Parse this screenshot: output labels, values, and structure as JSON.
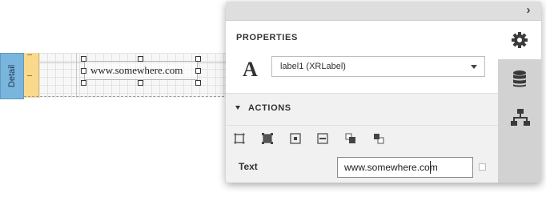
{
  "designer": {
    "band_label": "Detail",
    "label_text": "www.somewhere.com"
  },
  "panel": {
    "title": "PROPERTIES",
    "selected_component": "label1 (XRLabel)",
    "component_icon_glyph": "A",
    "actions_title": "ACTIONS",
    "text_property_label": "Text",
    "text_property_value": "www.somewhere.com",
    "side_tabs": [
      "gear-icon",
      "database-icon",
      "hierarchy-icon"
    ],
    "action_buttons": [
      "fit-bounds-to-text-icon",
      "fit-text-to-bounds-icon",
      "align-to-grid-icon",
      "size-to-grid-icon",
      "send-to-back-icon",
      "bring-to-front-icon"
    ]
  }
}
